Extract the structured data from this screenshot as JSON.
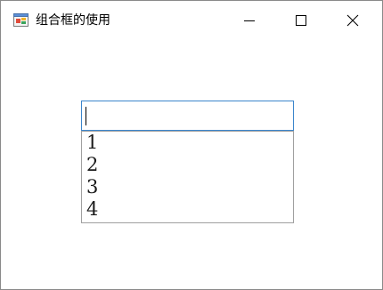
{
  "window": {
    "title": "组合框的使用",
    "app_icon": "winforms-app-icon",
    "controls": {
      "minimize_icon": "minimize-icon",
      "maximize_icon": "maximize-icon",
      "close_icon": "close-icon"
    }
  },
  "combobox": {
    "value": "",
    "items": [
      "1",
      "2",
      "3",
      "4"
    ],
    "accent_color": "#3c86cc"
  }
}
